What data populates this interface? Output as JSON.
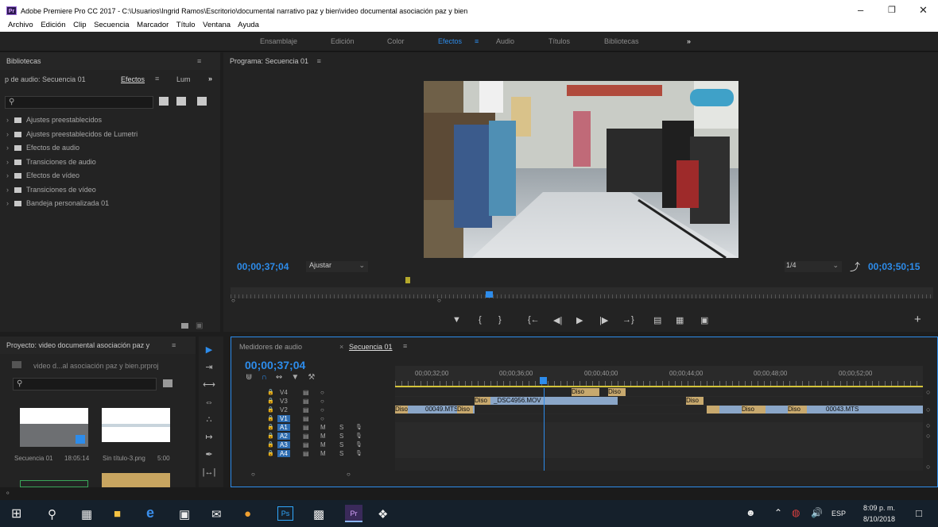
{
  "titlebar": {
    "title": "Adobe Premiere Pro CC 2017 - C:\\Usuarios\\Ingrid Ramos\\Escritorio\\documental narrativo paz y bien\\video documental asociación paz y bien"
  },
  "menu": [
    "Archivo",
    "Edición",
    "Clip",
    "Secuencia",
    "Marcador",
    "Título",
    "Ventana",
    "Ayuda"
  ],
  "workspaces": [
    "Ensamblaje",
    "Edición",
    "Color",
    "Efectos",
    "Audio",
    "Títulos",
    "Bibliotecas"
  ],
  "active_workspace": "Efectos",
  "libraries": {
    "title": "Bibliotecas"
  },
  "effects_panel": {
    "tab_left": "p de audio: Secuencia 01",
    "tab_active": "Efectos",
    "tab_right": "Lum",
    "folders": [
      "Ajustes preestablecidos",
      "Ajustes preestablecidos de Lumetri",
      "Efectos de audio",
      "Transiciones de audio",
      "Efectos de vídeo",
      "Transiciones de vídeo",
      "Bandeja personalizada 01"
    ]
  },
  "program": {
    "title": "Programa: Secuencia 01",
    "timecode": "00;00;37;04",
    "fit": "Ajustar",
    "quality": "1/4",
    "duration": "00;03;50;15"
  },
  "project": {
    "title": "Proyecto: video documental asociación paz y",
    "file": "video d...al asociación paz y bien.prproj",
    "items": [
      {
        "name": "Secuencia 01",
        "dur": "18:05:14"
      },
      {
        "name": "Sin título-3.png",
        "dur": "5:00"
      }
    ]
  },
  "timeline": {
    "tab_meters": "Medidores de audio",
    "tab_seq": "Secuencia 01",
    "timecode": "00;00;37;04",
    "ruler": [
      "00;00;32;00",
      "00;00;36;00",
      "00;00;40;00",
      "00;00;44;00",
      "00;00;48;00",
      "00;00;52;00"
    ],
    "tracks": [
      "V4",
      "V3",
      "V2",
      "V1",
      "A1",
      "A2",
      "A3",
      "A4"
    ],
    "clips": {
      "c1": "00049.MTS",
      "c2": "_DSC4956.MOV",
      "c3": "00043.MTS",
      "dis": "Diso"
    }
  },
  "taskbar": {
    "lang": "ESP",
    "time": "8:09 p. m.",
    "date": "8/10/2018"
  },
  "colors": {
    "accent": "#2d8ceb",
    "timecode": "#2d8ceb"
  }
}
